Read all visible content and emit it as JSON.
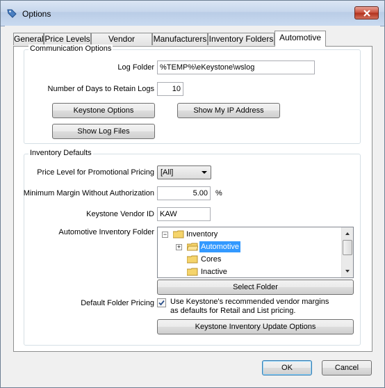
{
  "window": {
    "title": "Options"
  },
  "tabs": [
    "General",
    "Price Levels",
    "Vendor Catalogs",
    "Manufacturers",
    "Inventory Folders",
    "Automotive"
  ],
  "communication": {
    "group_label": "Communication Options",
    "log_folder_label": "Log Folder",
    "log_folder_value": "%TEMP%\\eKeystone\\wslog",
    "days_label": "Number of Days to Retain Logs",
    "days_value": "10",
    "keystone_options_button": "Keystone Options",
    "show_ip_button": "Show My IP Address",
    "show_log_files_button": "Show Log Files"
  },
  "inventory": {
    "group_label": "Inventory Defaults",
    "price_level_label": "Price Level for Promotional Pricing",
    "price_level_value": "[All]",
    "min_margin_label": "Minimum Margin Without Authorization",
    "min_margin_value": "5.00",
    "min_margin_unit": "%",
    "vendor_id_label": "Keystone Vendor ID",
    "vendor_id_value": "KAW",
    "folder_label": "Automotive Inventory Folder",
    "tree": [
      "Inventory",
      "Automotive",
      "Cores",
      "Inactive"
    ],
    "select_folder_button": "Select Folder",
    "default_pricing_label": "Default Folder Pricing",
    "default_pricing_checked": true,
    "default_pricing_text_1": "Use Keystone's recommended vendor margins",
    "default_pricing_text_2": "as defaults for Retail and List pricing.",
    "update_options_button": "Keystone Inventory Update Options"
  },
  "footer": {
    "ok": "OK",
    "cancel": "Cancel"
  },
  "colors": {
    "selection": "#3399ff",
    "folder": "#f5d46b"
  }
}
